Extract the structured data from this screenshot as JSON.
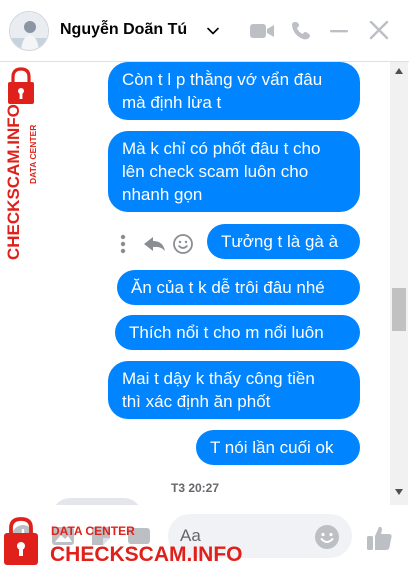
{
  "header": {
    "contact_name": "Nguyễn Doãn Tú",
    "icons": [
      "video-call-icon",
      "phone-icon",
      "minimize-icon",
      "close-icon"
    ]
  },
  "colors": {
    "bubble": "#0084ff",
    "accent": "#0084ff",
    "watermark_red": "#e0211b",
    "muted_icon": "#bcc0c4"
  },
  "thread": {
    "messages": [
      {
        "lines": [
          "Còn t l p thằng vớ vẩn đâu",
          "mà định lừa t"
        ]
      },
      {
        "lines": [
          "Mà k chỉ có phốt đâu t cho",
          "lên check scam luôn cho",
          "nhanh gọn"
        ]
      },
      {
        "lines": [
          "Tưởng t là gà à"
        ]
      },
      {
        "lines": [
          "Ăn của t k dễ trôi đâu nhé"
        ]
      },
      {
        "lines": [
          "Thích nổi t cho m nổi luôn"
        ]
      },
      {
        "lines": [
          "Mai t dậy k thấy công tiền",
          "thì xác định ăn phốt"
        ]
      },
      {
        "lines": [
          "T nói lần cuối ok"
        ]
      }
    ],
    "timestamp": "T3 20:27"
  },
  "composer": {
    "placeholder": "Aa"
  },
  "watermark": {
    "subtitle": "DATA CENTER",
    "brand": "CHECKSCAM.INFO"
  }
}
